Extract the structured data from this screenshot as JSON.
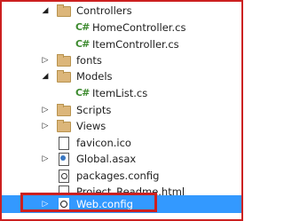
{
  "solution_explorer": {
    "items": [
      {
        "label": "Controllers",
        "icon": "folder-icon",
        "expanded": true
      },
      {
        "label": "HomeController.cs",
        "icon": "csharp-file-icon"
      },
      {
        "label": "ItemController.cs",
        "icon": "csharp-file-icon"
      },
      {
        "label": "fonts",
        "icon": "folder-icon",
        "expanded": false
      },
      {
        "label": "Models",
        "icon": "folder-icon",
        "expanded": true
      },
      {
        "label": "ItemList.cs",
        "icon": "csharp-file-icon"
      },
      {
        "label": "Scripts",
        "icon": "folder-icon",
        "expanded": false
      },
      {
        "label": "Views",
        "icon": "folder-icon",
        "expanded": false
      },
      {
        "label": "favicon.ico",
        "icon": "ico-file-icon"
      },
      {
        "label": "Global.asax",
        "icon": "asax-file-icon"
      },
      {
        "label": "packages.config",
        "icon": "config-file-icon"
      },
      {
        "label": "Project_Readme.html",
        "icon": "html-file-icon"
      },
      {
        "label": "Web.config",
        "icon": "web-config-icon",
        "selected": true
      }
    ],
    "cs_glyph": "C#"
  },
  "colors": {
    "selection": "#3399ff",
    "highlight_border": "#cc2020",
    "folder": "#dcb67a",
    "csharp": "#3c8a2e"
  }
}
